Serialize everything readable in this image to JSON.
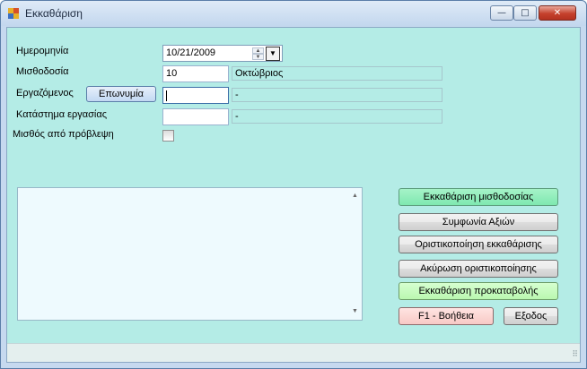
{
  "window": {
    "title": "Εκκαθάριση",
    "minimize_glyph": "—",
    "maximize_glyph": "□",
    "close_glyph": "✕"
  },
  "form": {
    "date": {
      "label": "Ημερομηνία",
      "value": "10/21/2009"
    },
    "payroll": {
      "label": "Μισθοδοσία",
      "value": "10",
      "description": "Οκτώβριος"
    },
    "employee": {
      "label": "Εργαζόμενος",
      "lookup_button": "Επωνυμία",
      "value": "",
      "description": "-"
    },
    "store": {
      "label": "Κατάστημα εργασίας",
      "value": "",
      "description": "-"
    },
    "salary_forecast": {
      "label": "Μισθός από πρόβλεψη",
      "checked": false
    }
  },
  "actions": {
    "process_payroll": "Εκκαθάριση μισθοδοσίας",
    "share_agreement": "Συμφωνία Αξιών",
    "finalize": "Οριστικοποίηση εκκαθάρισης",
    "cancel_finalize": "Ακύρωση οριστικοποίησης",
    "process_advance": "Εκκαθάριση προκαταβολής",
    "help": "F1 - Βοήθεια",
    "exit": "Εξοδος"
  },
  "colors": {
    "client_bg": "#b4ece6",
    "accent_green": "#7ee8b0",
    "accent_light_green": "#baf7b0",
    "accent_pink": "#f8c9c5"
  },
  "icons": {
    "spin_up": "▲",
    "spin_down": "▼",
    "dropdown": "▼",
    "scroll_up": "▲",
    "scroll_down": "▼",
    "grip": "⠿"
  }
}
